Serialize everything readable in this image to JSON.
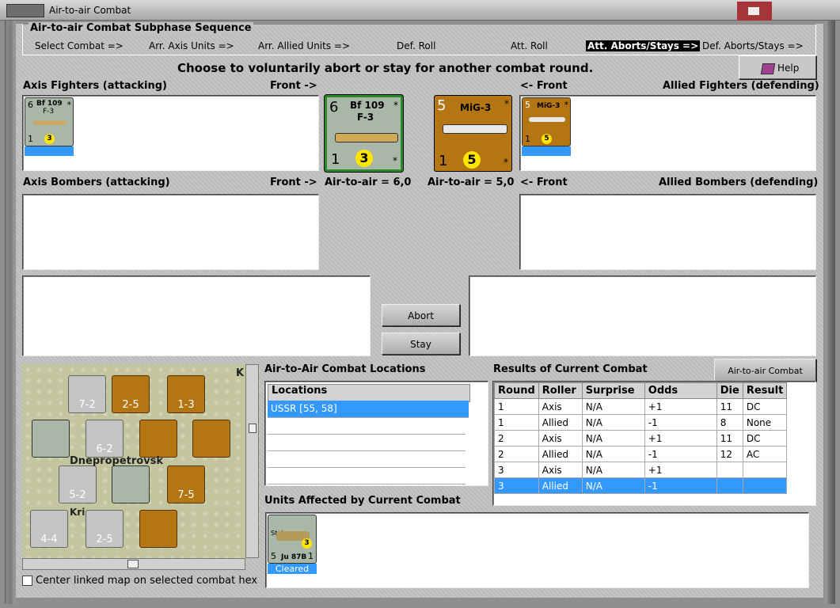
{
  "window": {
    "title": "Air-to-air Combat"
  },
  "sequence": {
    "title": "Air-to-air Combat Subphase Sequence",
    "steps": [
      "Select Combat =>",
      "Arr. Axis Units =>",
      "Arr. Allied Units =>",
      "Def. Roll",
      "Att. Roll",
      "Att. Aborts/Stays =>",
      "Def. Aborts/Stays =>"
    ],
    "active_step": "Att. Aborts/Stays =>"
  },
  "prompt": "Choose to voluntarily abort or stay for another combat round.",
  "help_label": "Help",
  "labels": {
    "axis_fighters": "Axis Fighters (attacking)",
    "front_right": "Front ->",
    "front_left": "<- Front",
    "allied_fighters": "Allied Fighters (defending)",
    "axis_bombers": "Axis Bombers (attacking)",
    "allied_bombers": "Allied Bombers (defending)",
    "axis_ata": "Air-to-air = 6,0",
    "allied_ata": "Air-to-air = 5,0",
    "locations_title": "Air-to-Air Combat Locations",
    "results_title": "Results of Current Combat",
    "affected_title": "Units Affected by Current Combat",
    "center_map": "Center linked map on selected combat hex"
  },
  "counters": {
    "axis_fighter": {
      "name": "Bf 109",
      "variant": "F-3",
      "attack": "6",
      "defense": "1",
      "range": "3",
      "mark": "*",
      "color": "#a9b7a8"
    },
    "allied_fighter": {
      "name": "MiG-3",
      "attack": "5",
      "defense": "1",
      "range": "5",
      "mark": "*",
      "color": "#b47613"
    },
    "affected": {
      "name": "Ju 87B",
      "type": "Stuka",
      "attack": "5",
      "defense": "1",
      "range": "3",
      "status": "Cleared"
    }
  },
  "buttons": {
    "abort": "Abort",
    "stay": "Stay",
    "chart": "Air-to-air Combat Chart"
  },
  "locations": {
    "header": "Locations",
    "items": [
      "USSR [55, 58]"
    ]
  },
  "results": {
    "columns": [
      "Round",
      "Roller",
      "Surprise",
      "Odds",
      "Die",
      "Result"
    ],
    "rows": [
      [
        "1",
        "Axis",
        "N/A",
        "+1",
        "11",
        "DC"
      ],
      [
        "1",
        "Allied",
        "N/A",
        "-1",
        "8",
        "None"
      ],
      [
        "2",
        "Axis",
        "N/A",
        "+1",
        "11",
        "DC"
      ],
      [
        "2",
        "Allied",
        "N/A",
        "-1",
        "12",
        "AC"
      ],
      [
        "3",
        "Axis",
        "N/A",
        "+1",
        "",
        ""
      ],
      [
        "3",
        "Allied",
        "N/A",
        "-1",
        "",
        ""
      ]
    ],
    "selected_row": 5
  },
  "map": {
    "city_label": "Dnepropetrovsk",
    "city_label2": "Kri",
    "corner_label": "K",
    "units": [
      {
        "t": "7-2"
      },
      {
        "t": "2-5"
      },
      {
        "t": "1-3"
      },
      {
        "t": "6-2"
      },
      {
        "t": "5-2"
      },
      {
        "t": "7-5"
      },
      {
        "t": "4-4"
      },
      {
        "t": "2-5"
      }
    ]
  }
}
